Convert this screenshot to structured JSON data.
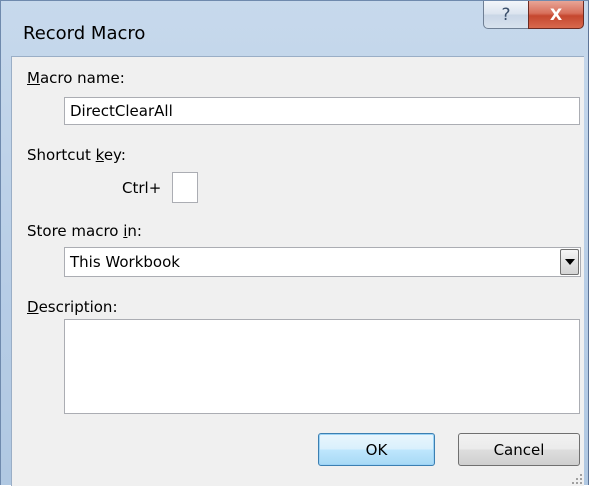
{
  "window": {
    "title": "Record Macro",
    "help_label": "?",
    "close_label": "X"
  },
  "macro_name": {
    "label_mnemonic": "M",
    "label_rest": "acro name:",
    "value": "DirectClearAll"
  },
  "shortcut": {
    "label_before": "Shortcut ",
    "label_mnemonic": "k",
    "label_after": "ey:",
    "prefix": "Ctrl+",
    "value": ""
  },
  "store_in": {
    "label_before": "Store macro ",
    "label_mnemonic": "i",
    "label_after": "n:",
    "selected": "This Workbook"
  },
  "description": {
    "label_mnemonic": "D",
    "label_rest": "escription:",
    "value": ""
  },
  "buttons": {
    "ok": "OK",
    "cancel": "Cancel"
  },
  "colors": {
    "titlebar": "#c7d9ec",
    "client": "#f0f0f0",
    "close": "#c5472f",
    "default_button": "#bee6fd"
  }
}
